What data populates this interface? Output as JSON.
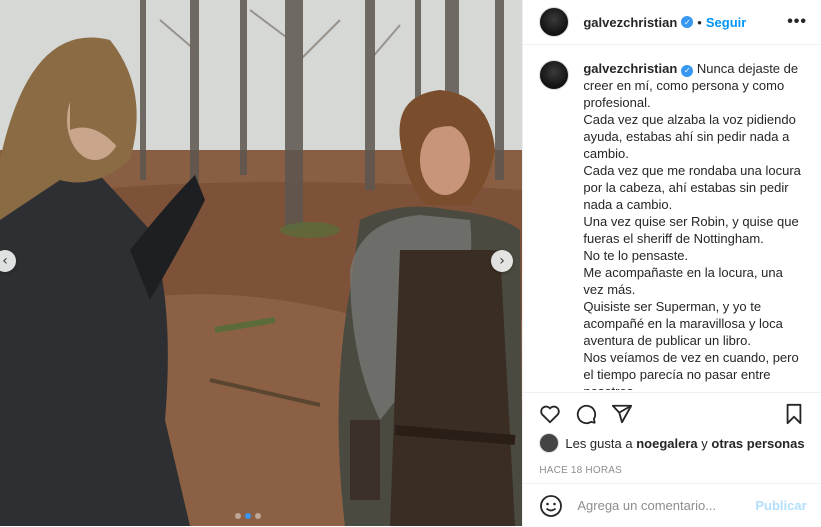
{
  "post": {
    "username": "galvezchristian",
    "separator": "•",
    "follow_label": "Seguir",
    "more_label": "•••",
    "caption_paragraphs": [
      "Nunca dejaste de creer en mí, como persona y como profesional.",
      "Cada vez que alzaba la voz pidiendo ayuda, estabas ahí sin pedir nada a cambio.",
      "Cada vez que me rondaba una locura por la cabeza, ahí estabas sin pedir nada a cambio.",
      "Una vez quise ser Robin, y quise que fueras el sheriff de Nottingham.",
      "No te lo pensaste.",
      "Me acompañaste en la locura, una vez más.",
      "Quisiste ser Superman, y yo te acompañé en la maravillosa y loca aventura de publicar un libro.",
      "Nos veíamos de vez en cuando, pero el tiempo parecía no pasar entre nosotros."
    ],
    "likes": {
      "prefix": "Les gusta a",
      "user": "noegalera",
      "conjunction": "y",
      "others": "otras personas"
    },
    "timestamp": "HACE 18 HORAS",
    "comment_placeholder": "Agrega un comentario...",
    "publish_label": "Publicar"
  },
  "carousel": {
    "prev_label": "‹",
    "next_label": "›",
    "slide_count": 3,
    "active_slide": 1
  },
  "icons": {
    "verified": "verified-badge-icon",
    "like": "heart-icon",
    "comment": "comment-icon",
    "share": "share-icon",
    "save": "bookmark-icon",
    "emoji": "emoji-icon"
  },
  "colors": {
    "accent": "#0095f6",
    "verified": "#3897f0",
    "publish_disabled": "#b2dffc",
    "text": "#262626",
    "muted": "#8e8e8e"
  }
}
